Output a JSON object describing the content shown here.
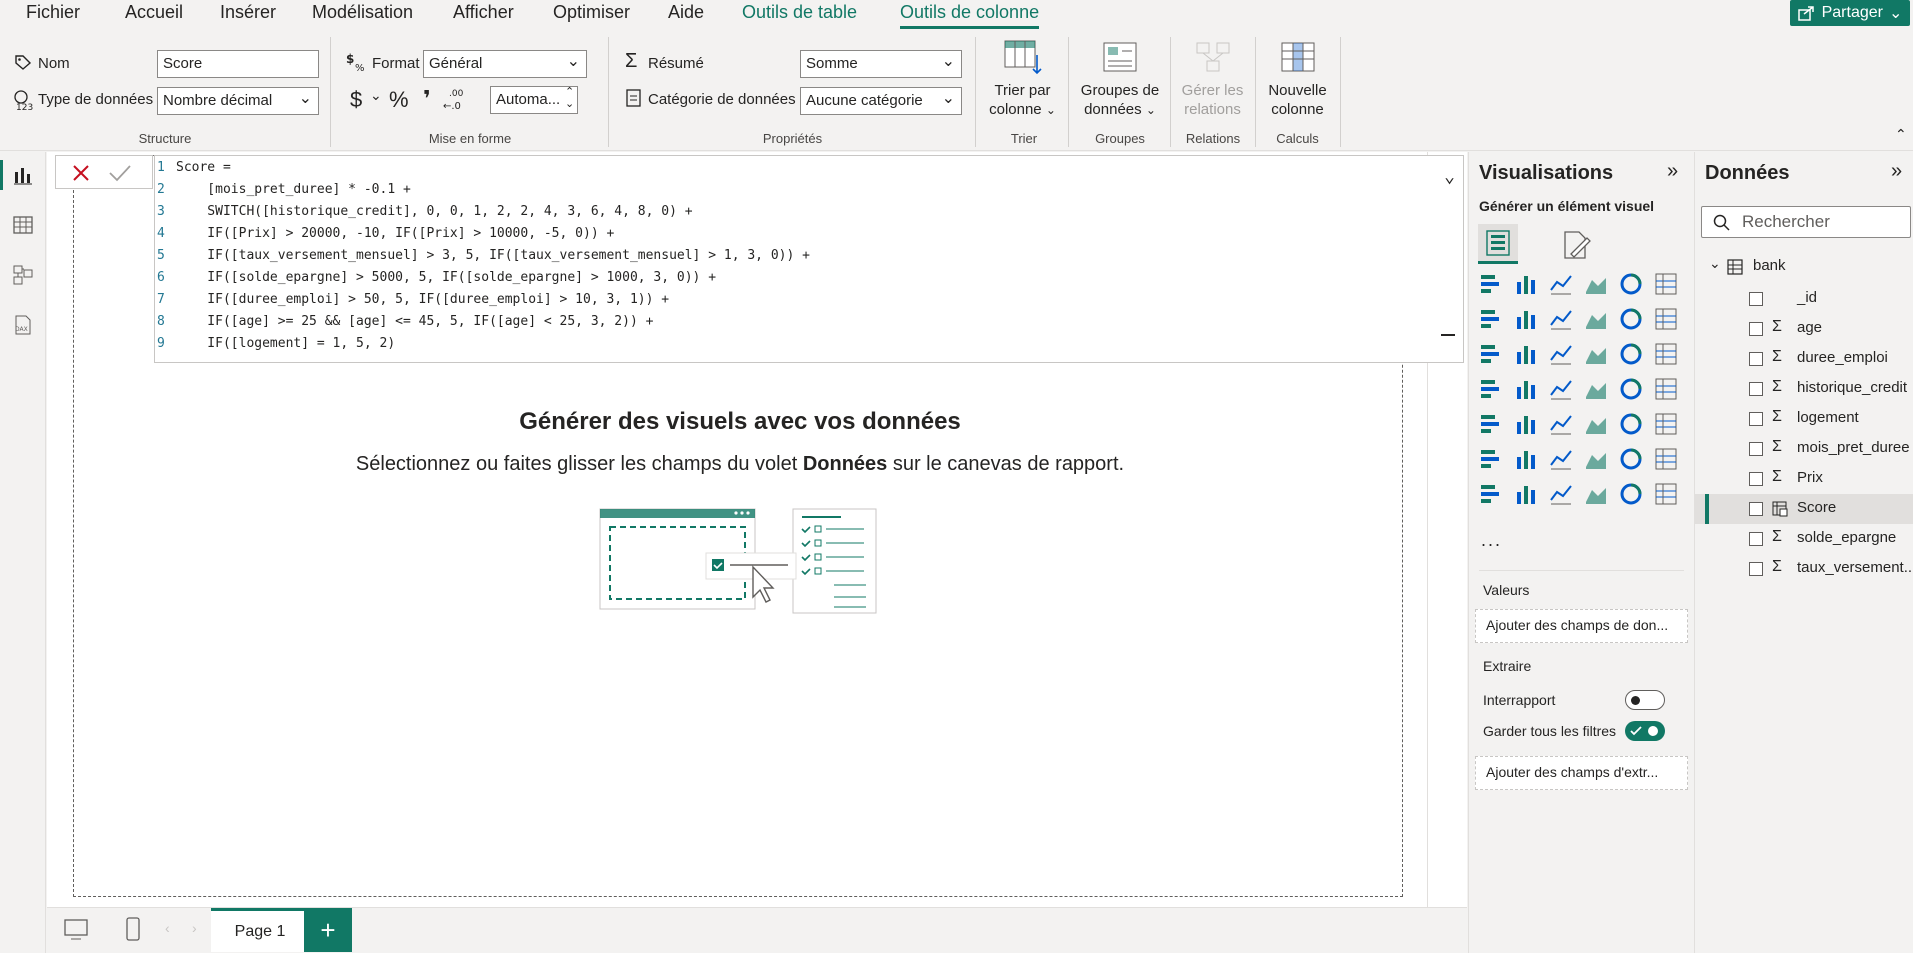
{
  "menu": {
    "items": [
      "Fichier",
      "Accueil",
      "Insérer",
      "Modélisation",
      "Afficher",
      "Optimiser",
      "Aide",
      "Outils de table",
      "Outils de colonne"
    ],
    "share": "Partager"
  },
  "ribbon": {
    "structure": {
      "name_label": "Nom",
      "name_value": "Score",
      "type_label": "Type de données",
      "type_value": "Nombre décimal",
      "group": "Structure"
    },
    "format": {
      "format_label": "Format",
      "format_value": "Général",
      "currency": "$",
      "percent": "%",
      "comma": "❜",
      "decimals": "Automa...",
      "group": "Mise en forme"
    },
    "properties": {
      "summary_label": "Résumé",
      "summary_value": "Somme",
      "category_label": "Catégorie de données",
      "category_value": "Aucune catégorie",
      "group": "Propriétés"
    },
    "sort": {
      "line1": "Trier par",
      "line2": "colonne",
      "group": "Trier"
    },
    "groups": {
      "line1": "Groupes de",
      "line2": "données",
      "group": "Groupes"
    },
    "relations": {
      "line1": "Gérer les",
      "line2": "relations",
      "group": "Relations"
    },
    "calc": {
      "line1": "Nouvelle",
      "line2": "colonne",
      "group": "Calculs"
    }
  },
  "formula": {
    "lines": [
      "Score =",
      "    [mois_pret_duree] * -0.1 +",
      "    SWITCH([historique_credit], 0, 0, 1, 2, 2, 4, 3, 6, 4, 8, 0) +",
      "    IF([Prix] > 20000, -10, IF([Prix] > 10000, -5, 0)) +",
      "    IF([taux_versement_mensuel] > 3, 5, IF([taux_versement_mensuel] > 1, 3, 0)) +",
      "    IF([solde_epargne] > 5000, 5, IF([solde_epargne] > 1000, 3, 0)) +",
      "    IF([duree_emploi] > 50, 5, IF([duree_emploi] > 10, 3, 1)) +",
      "    IF([age] >= 25 && [age] <= 45, 5, IF([age] < 25, 3, 2)) +",
      "    IF([logement] = 1, 5, 2)"
    ],
    "line_numbers": [
      "1",
      "2",
      "3",
      "4",
      "5",
      "6",
      "7",
      "8",
      "9"
    ]
  },
  "canvas": {
    "empty_title": "Générer des visuels avec vos données",
    "empty_sub_before": "Sélectionnez ou faites glisser les champs du volet ",
    "empty_sub_bold": "Données",
    "empty_sub_after": " sur le canevas de rapport."
  },
  "pages": {
    "tab": "Page 1",
    "add": "+"
  },
  "visualisations": {
    "title": "Visualisations",
    "build_label": "Générer un élément visuel",
    "more": "...",
    "values_label": "Valeurs",
    "values_drop": "Ajouter des champs de don...",
    "drill_label": "Extraire",
    "cross_report": "Interrapport",
    "keep_filters": "Garder tous les filtres",
    "drill_drop": "Ajouter des champs d'extr..."
  },
  "data": {
    "title": "Données",
    "search_placeholder": "Rechercher",
    "table": "bank",
    "fields": [
      {
        "name": "_id",
        "sym": ""
      },
      {
        "name": "age",
        "sym": "Σ"
      },
      {
        "name": "duree_emploi",
        "sym": "Σ"
      },
      {
        "name": "historique_credit",
        "sym": "Σ"
      },
      {
        "name": "logement",
        "sym": "Σ"
      },
      {
        "name": "mois_pret_duree",
        "sym": "Σ"
      },
      {
        "name": "Prix",
        "sym": "Σ"
      },
      {
        "name": "Score",
        "sym": "calc"
      },
      {
        "name": "solde_epargne",
        "sym": "Σ"
      },
      {
        "name": "taux_versement...",
        "sym": "Σ"
      }
    ]
  },
  "colors": {
    "accent": "#117865",
    "pane_bg": "#f3f2f1"
  }
}
